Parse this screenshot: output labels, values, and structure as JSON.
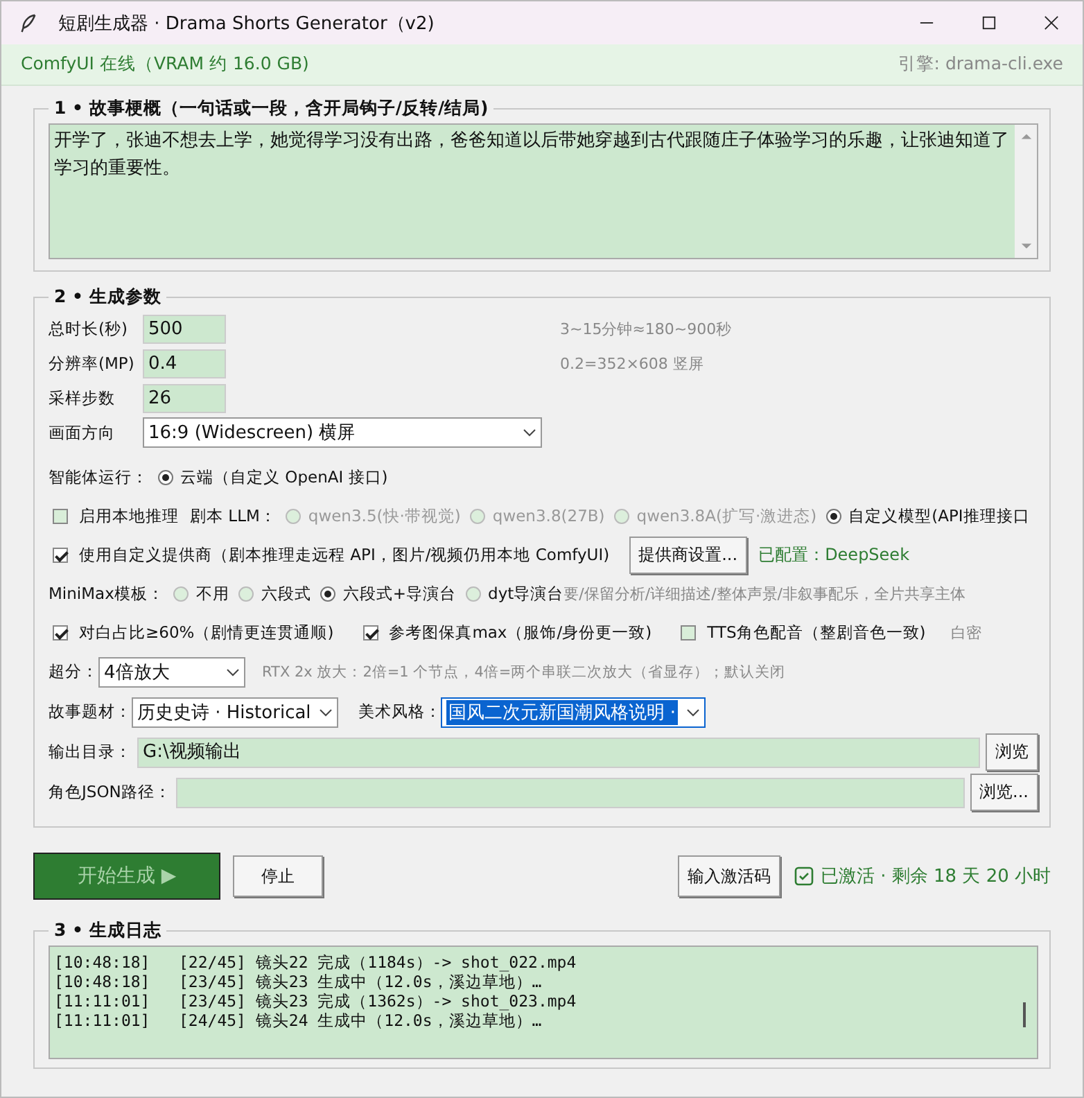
{
  "window": {
    "title": "短剧生成器 · Drama Shorts Generator（v2)"
  },
  "status_bar": {
    "left": "ComfyUI 在线（VRAM 约 16.0 GB)",
    "right": "引擎: drama-cli.exe"
  },
  "story": {
    "title": "1 • 故事梗概（一句话或一段，含开局钩子/反转/结局)",
    "text": "开学了，张迪不想去上学，她觉得学习没有出路，爸爸知道以后带她穿越到古代跟随庄子体验学习的乐趣，让张迪知道了学习的重要性。"
  },
  "params": {
    "title": "2 • 生成参数",
    "fields": [
      {
        "label": "总时长(秒)",
        "value": "500",
        "hint": "3~15分钟≈180~900秒"
      },
      {
        "label": "分辨率(MP)",
        "value": "0.4",
        "hint": "0.2=352×608 竖屏"
      },
      {
        "label": "采样步数",
        "value": "26"
      }
    ],
    "orientation": {
      "label": "画面方向",
      "value": "16:9 (Widescreen) 横屏"
    },
    "agent": {
      "label": "智能体运行：",
      "options": [
        {
          "label": "云端（自定义 OpenAI 接口)",
          "selected": true
        }
      ]
    },
    "local_inference": {
      "label": "启用本地推理",
      "checked": false
    },
    "llm": {
      "label": "剧本 LLM：",
      "options": [
        {
          "label": "qwen3.5(快·带视觉)",
          "selected": false,
          "disabled": true
        },
        {
          "label": "qwen3.8(27B)",
          "selected": false,
          "disabled": true
        },
        {
          "label": "qwen3.8A(扩写·激进态)",
          "selected": false,
          "disabled": true
        },
        {
          "label": "自定义模型(API推理接口",
          "selected": true,
          "disabled": false
        }
      ]
    },
    "custom_provider": {
      "label": "使用自定义提供商（剧本推理走远程 API，图片/视频仍用本地 ComfyUI)",
      "checked": true,
      "button": "提供商设置...",
      "status": "已配置：DeepSeek"
    },
    "minimax": {
      "label": "MiniMax模板：",
      "options": [
        {
          "label": "不用",
          "selected": false
        },
        {
          "label": "六段式",
          "selected": false
        },
        {
          "label": "六段式+导演台",
          "selected": true
        },
        {
          "label": "dyt导演台",
          "selected": false
        }
      ],
      "hint": "要/保留分析/详细描述/整体声景/非叙事配乐，全片共享主体"
    },
    "checkboxes": [
      {
        "label": "对白占比≥60%（剧情更连贯通顺)",
        "checked": true
      },
      {
        "label": "参考图保真max（服饰/身份更一致)",
        "checked": true
      },
      {
        "label": "TTS角色配音（整剧音色一致)",
        "checked": false
      }
    ],
    "trailing_text": "白密",
    "upscale": {
      "label": "超分：",
      "value": "4倍放大",
      "hint": "RTX 2x 放大：2倍=1 个节点，4倍=两个串联二次放大（省显存）；默认关闭"
    },
    "theme": {
      "label": "故事题材：",
      "value": "历史史诗 · Historical"
    },
    "art_style": {
      "label": "美术风格：",
      "value": "国风二次元新国潮风格说明 ·",
      "selected": true
    },
    "output_dir": {
      "label": "输出目录：",
      "value": "G:\\视频输出",
      "button": "浏览"
    },
    "char_json": {
      "label": "角色JSON路径：",
      "button": "浏览..."
    }
  },
  "actions": {
    "start": {
      "label": "开始生成 ▶",
      "disabled": true
    },
    "stop": "停止",
    "activate": "输入激活码",
    "activation": {
      "text": "已激活 · 剩余 18 天 20 小时",
      "checked": true
    }
  },
  "log": {
    "title": "3 • 生成日志",
    "lines": [
      "[10:48:18]   [22/45] 镜头22 完成（1184s）-> shot_022.mp4",
      "[10:48:18]   [23/45] 镜头23 生成中（12.0s，溪边草地）…",
      "[11:11:01]   [23/45] 镜头23 完成（1362s）-> shot_023.mp4",
      "[11:11:01]   [24/45] 镜头24 生成中（12.0s，溪边草地）…"
    ]
  }
}
